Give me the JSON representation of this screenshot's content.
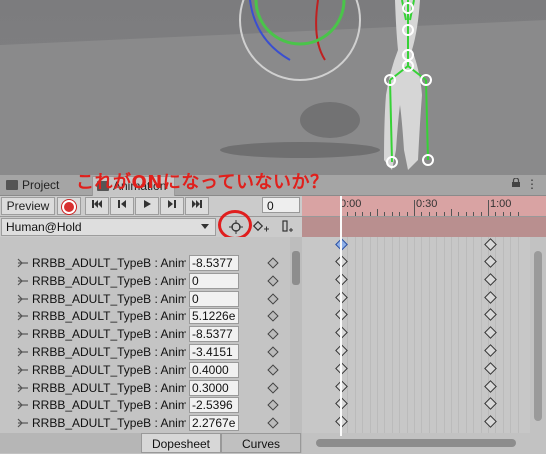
{
  "annotation": "これがONになっていないか？",
  "window": {
    "tab_project": "Project",
    "tab_animation": "Animation",
    "menu_glyph": "⋮"
  },
  "toolbar": {
    "preview_label": "Preview",
    "frame_value": "0",
    "clip_name": "Human@Hold"
  },
  "timeline": {
    "labels": [
      "0:00",
      "0:30",
      "1:00"
    ],
    "colors": {
      "recording_ruler": "#d9a3a3",
      "annotation": "#e0201c"
    }
  },
  "properties": [
    {
      "name": "RRBB_ADULT_TypeB : Anim",
      "value": "-8.5377"
    },
    {
      "name": "RRBB_ADULT_TypeB : Anim",
      "value": "0"
    },
    {
      "name": "RRBB_ADULT_TypeB : Anim",
      "value": "0"
    },
    {
      "name": "RRBB_ADULT_TypeB : Anim",
      "value": "5.1226e"
    },
    {
      "name": "RRBB_ADULT_TypeB : Anim",
      "value": "-8.5377"
    },
    {
      "name": "RRBB_ADULT_TypeB : Anim",
      "value": "-3.4151"
    },
    {
      "name": "RRBB_ADULT_TypeB : Anim",
      "value": "0.4000"
    },
    {
      "name": "RRBB_ADULT_TypeB : Anim",
      "value": "0.3000"
    },
    {
      "name": "RRBB_ADULT_TypeB : Anim",
      "value": "-2.5396"
    },
    {
      "name": "RRBB_ADULT_TypeB : Anim",
      "value": "2.2767e"
    }
  ],
  "bottom_tabs": {
    "dopesheet": "Dopesheet",
    "curves": "Curves"
  }
}
